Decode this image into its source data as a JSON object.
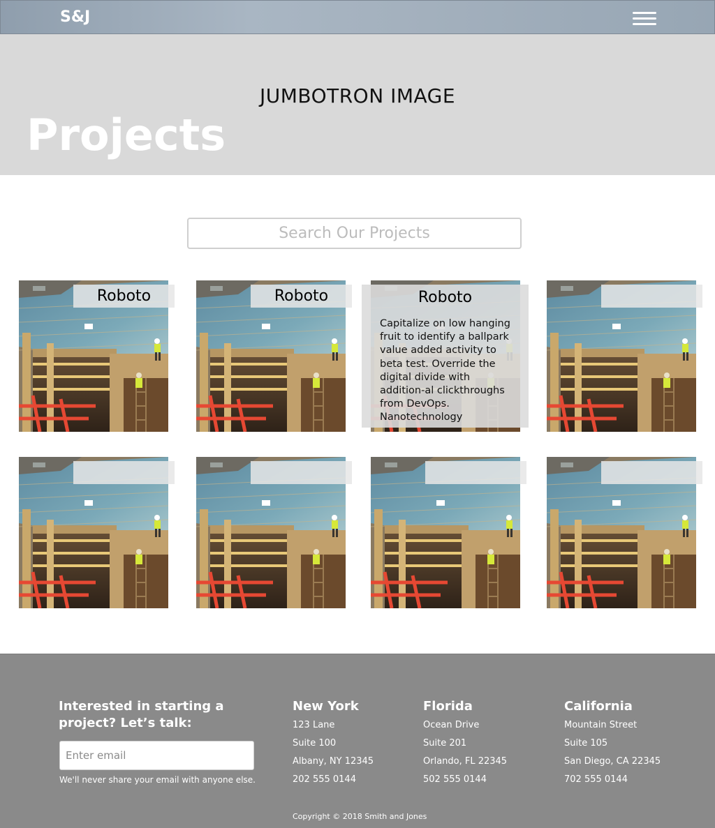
{
  "header": {
    "brand": "S&J"
  },
  "jumbotron": {
    "caption": "JUMBOTRON IMAGE",
    "title": "Projects"
  },
  "search": {
    "placeholder": "Search Our Projects"
  },
  "projects": [
    {
      "label": "Roboto"
    },
    {
      "label": "Roboto"
    },
    {
      "label": "Roboto",
      "description": "Capitalize on low hanging fruit to identify a ballpark value added activity to beta test. Override the digital divide with addition-al clickthroughs from DevOps. Nanotechnology"
    },
    {
      "label": ""
    },
    {
      "label": ""
    },
    {
      "label": ""
    },
    {
      "label": ""
    },
    {
      "label": ""
    }
  ],
  "footer": {
    "cta": "Interested in starting a project? Let’s talk:",
    "email_placeholder": "Enter email",
    "privacy": "We'll never share your email with anyone else.",
    "offices": [
      {
        "name": "New York",
        "lines": [
          "123 Lane",
          "Suite 100",
          "Albany, NY 12345",
          "202 555 0144"
        ]
      },
      {
        "name": "Florida",
        "lines": [
          "Ocean Drive",
          "Suite 201",
          "Orlando, FL 22345",
          "502 555 0144"
        ]
      },
      {
        "name": "California",
        "lines": [
          "Mountain Street",
          "Suite 105",
          "San Diego, CA 22345",
          "702 555 0144"
        ]
      }
    ],
    "copyright": "Copyright © 2018 Smith and Jones"
  },
  "colors": {
    "nav": "#9fadbb",
    "jumbotron": "#d9d9d9",
    "footer": "#8a8a8a"
  },
  "icons": {
    "menu": "hamburger-icon"
  }
}
